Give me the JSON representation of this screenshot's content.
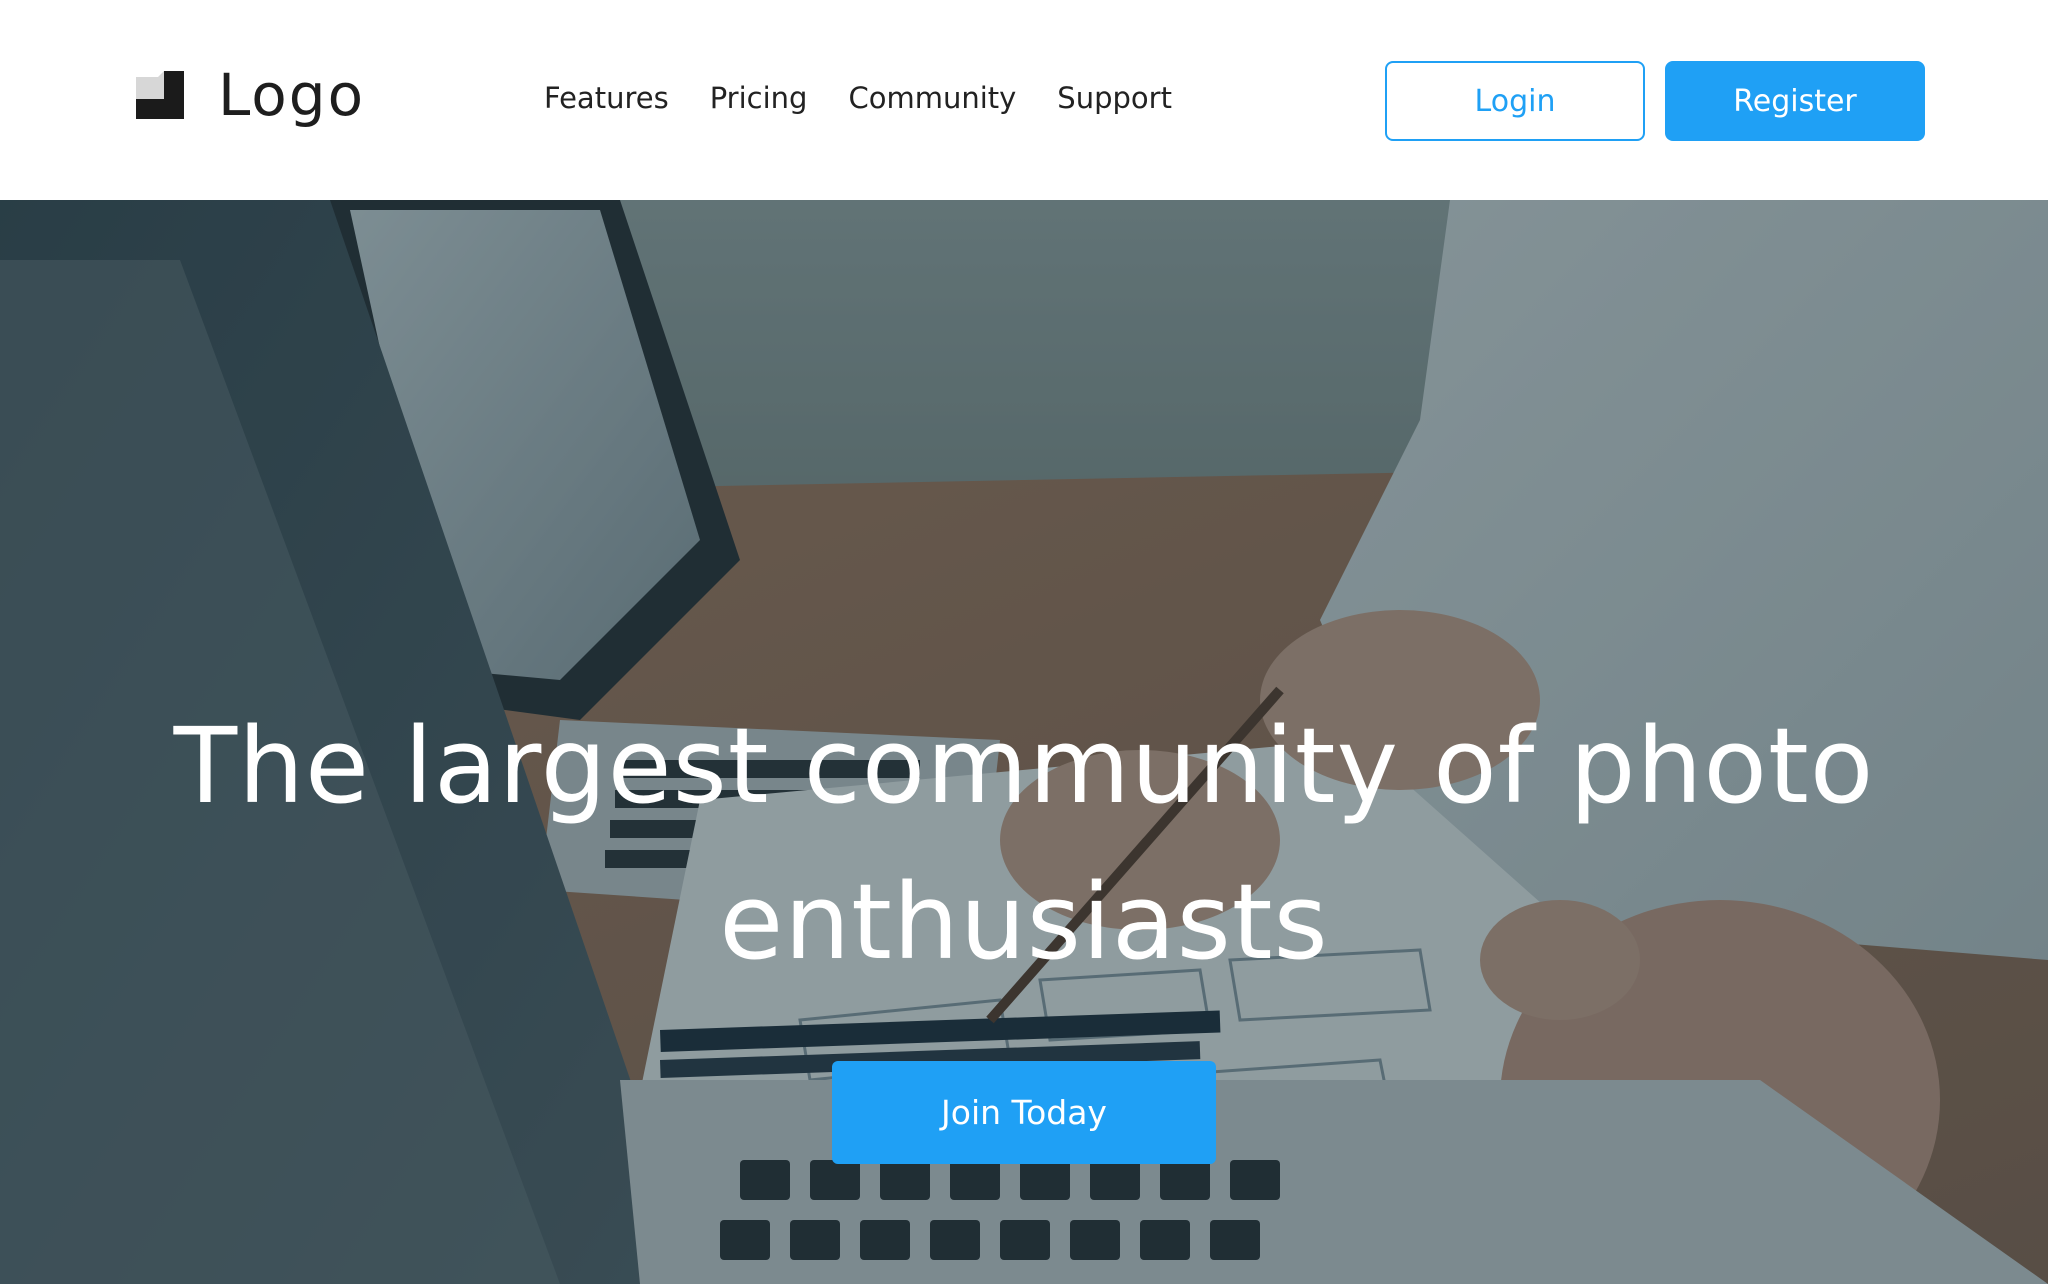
{
  "header": {
    "logo_text": "Logo",
    "nav": [
      {
        "label": "Features"
      },
      {
        "label": "Pricing"
      },
      {
        "label": "Community"
      },
      {
        "label": "Support"
      }
    ],
    "login_label": "Login",
    "register_label": "Register"
  },
  "hero": {
    "title": "The largest community of photo enthusiasts",
    "cta_label": "Join Today",
    "background": "photo-desk-laptops-hands-sketch"
  },
  "colors": {
    "accent": "#1fa0f5",
    "text_dark": "#222222",
    "white": "#ffffff"
  },
  "icons": {
    "logo": "cube-logo-icon"
  }
}
